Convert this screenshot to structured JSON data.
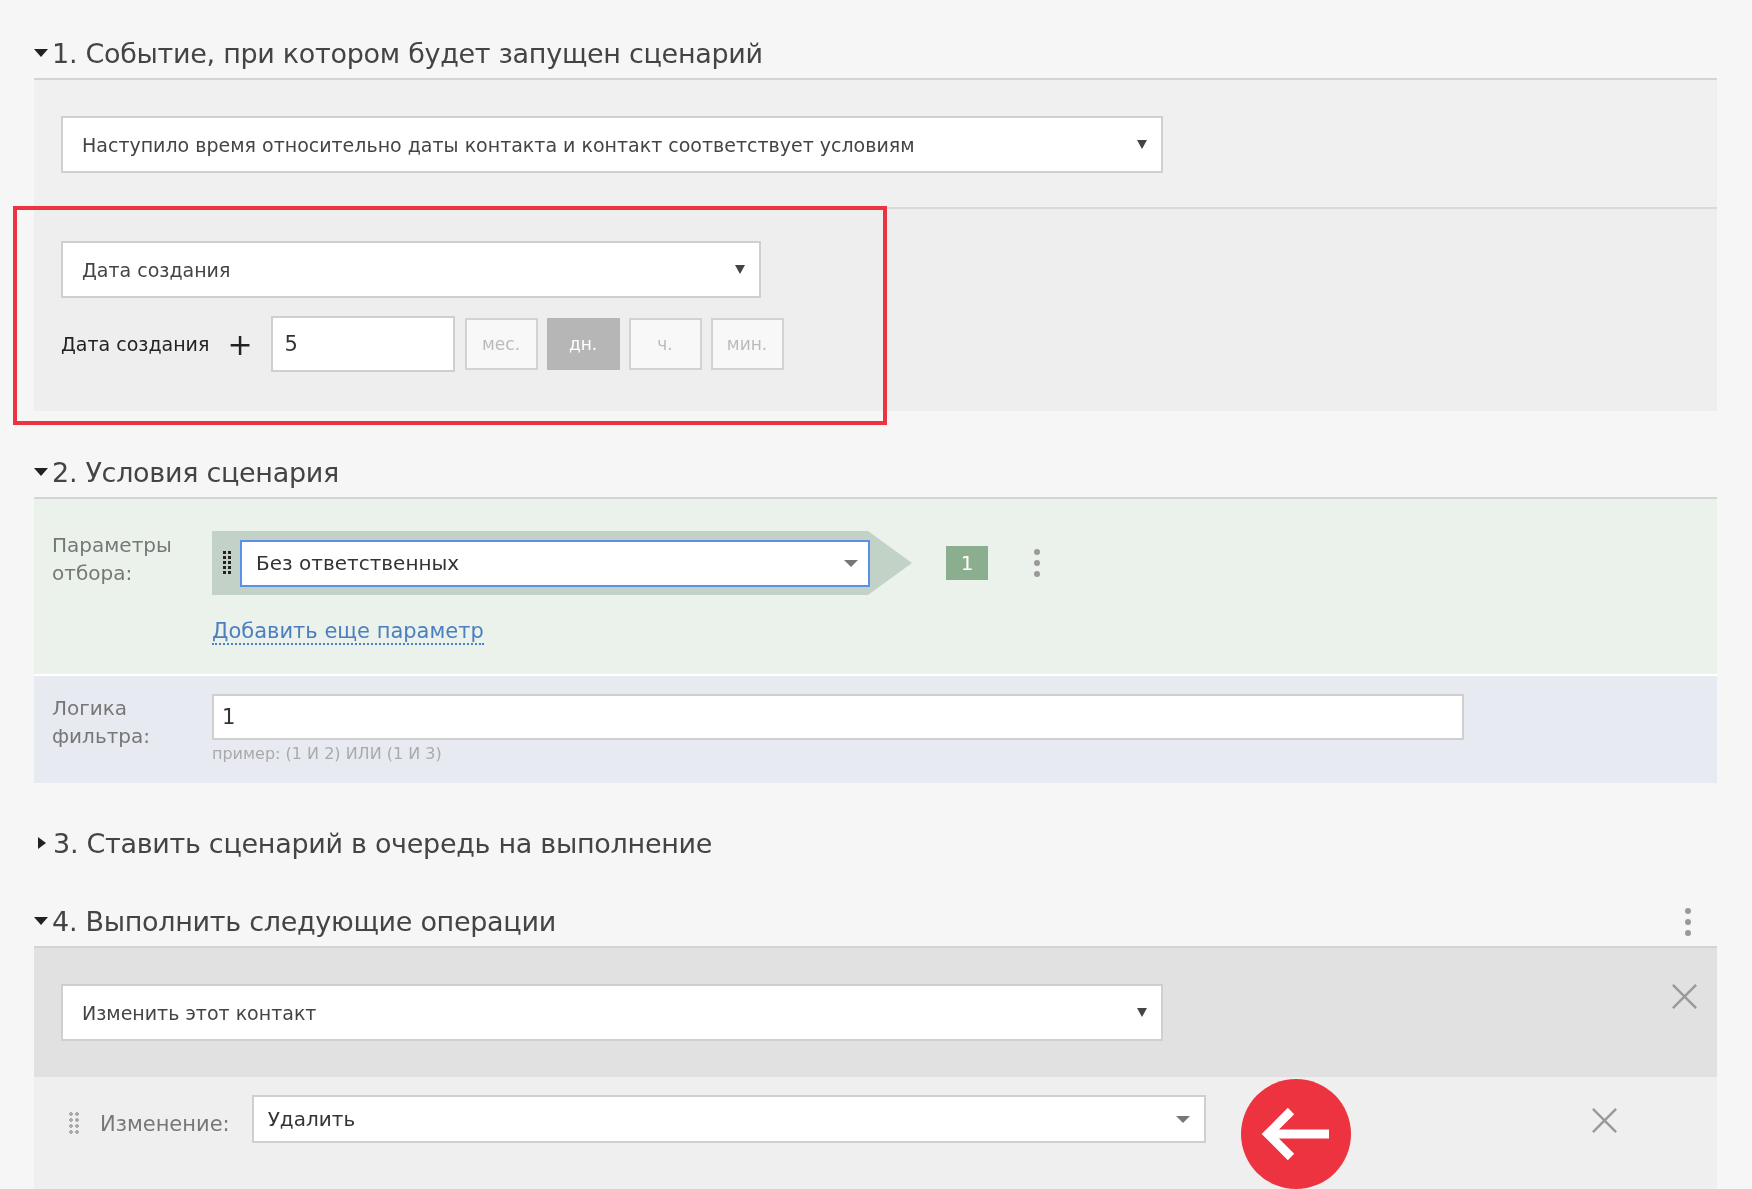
{
  "section_1": {
    "title": "1. Событие, при котором будет запущен сценарий",
    "expanded": true,
    "event_select": {
      "value": "Наступило время относительно даты контакта и контакт соответствует условиям"
    },
    "date_select": {
      "value": "Дата создания"
    },
    "offset_label": "Дата создания",
    "plus": "+",
    "offset_input": {
      "value": "5"
    },
    "units": [
      {
        "label": "мес.",
        "selected": false
      },
      {
        "label": "дн.",
        "selected": true
      },
      {
        "label": "ч.",
        "selected": false
      },
      {
        "label": "мин.",
        "selected": false
      }
    ]
  },
  "section_2": {
    "title": "2. Условия сценария",
    "expanded": true,
    "params_label": "Параметры отбора:",
    "param_select": {
      "value": "Без ответственных"
    },
    "param_number": "1",
    "add_link": "Добавить еще параметр",
    "logic_label": "Логика фильтра:",
    "logic_input": {
      "value": "1"
    },
    "logic_hint": "пример: (1 И 2) ИЛИ (1 И 3)"
  },
  "section_3": {
    "title": "3. Ставить сценарий в очередь на выполнение",
    "expanded": false
  },
  "section_4": {
    "title": "4. Выполнить следующие операции",
    "expanded": true,
    "action_select": {
      "value": "Изменить этот контакт"
    },
    "change_label": "Изменение:",
    "change_select": {
      "value": "Удалить"
    }
  }
}
